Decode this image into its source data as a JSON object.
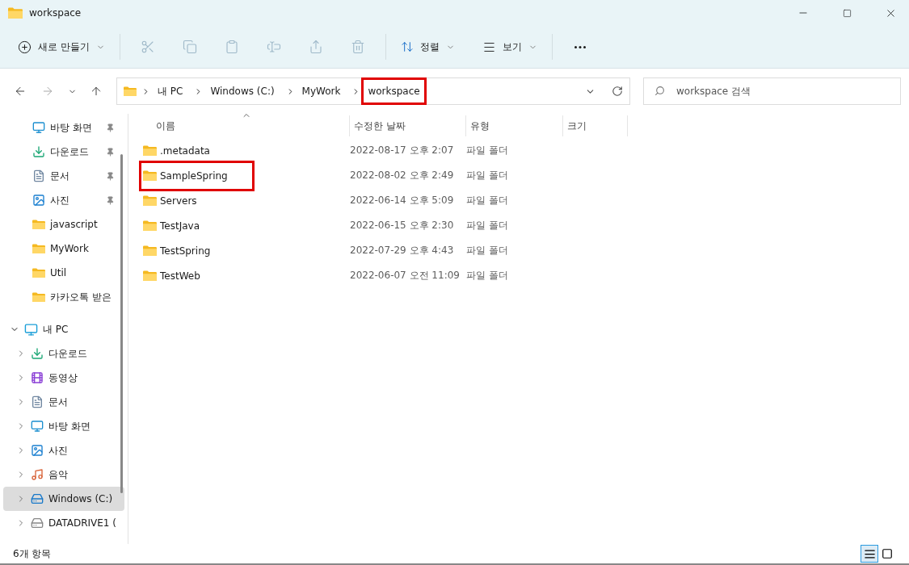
{
  "window": {
    "title": "workspace"
  },
  "toolbar": {
    "new_label": "새로 만들기",
    "actions": [
      {
        "kind": "cut",
        "disabled": true
      },
      {
        "kind": "copy",
        "disabled": true
      },
      {
        "kind": "paste",
        "disabled": true
      },
      {
        "kind": "rename",
        "disabled": true
      },
      {
        "kind": "share",
        "disabled": true
      },
      {
        "kind": "delete",
        "disabled": true
      }
    ],
    "sort_label": "정렬",
    "view_label": "보기"
  },
  "navigation": {
    "back_disabled": false,
    "forward_disabled": true
  },
  "breadcrumb": [
    {
      "label": "내 PC",
      "highlighted": false
    },
    {
      "label": "Windows  (C:)",
      "highlighted": false
    },
    {
      "label": "MyWork",
      "highlighted": false
    },
    {
      "label": "workspace",
      "highlighted": true
    }
  ],
  "search": {
    "placeholder": "workspace 검색"
  },
  "sidebar": {
    "quick_access": [
      {
        "label": "바탕 화면",
        "kind": "desktop",
        "pinned": true
      },
      {
        "label": "다운로드",
        "kind": "download",
        "pinned": true
      },
      {
        "label": "문서",
        "kind": "documents",
        "pinned": true
      },
      {
        "label": "사진",
        "kind": "pictures",
        "pinned": true
      },
      {
        "label": "javascript",
        "kind": "folder",
        "pinned": false
      },
      {
        "label": "MyWork",
        "kind": "folder",
        "pinned": false
      },
      {
        "label": "Util",
        "kind": "folder",
        "pinned": false
      },
      {
        "label": "카카오톡 받은",
        "kind": "folder",
        "pinned": false
      }
    ],
    "this_pc": {
      "label": "내 PC",
      "expanded": true,
      "children": [
        {
          "label": "다운로드",
          "kind": "download",
          "selected": false
        },
        {
          "label": "동영상",
          "kind": "videos",
          "selected": false
        },
        {
          "label": "문서",
          "kind": "documents",
          "selected": false
        },
        {
          "label": "바탕 화면",
          "kind": "desktop",
          "selected": false
        },
        {
          "label": "사진",
          "kind": "pictures",
          "selected": false
        },
        {
          "label": "음악",
          "kind": "music",
          "selected": false
        },
        {
          "label": "Windows  (C:)",
          "kind": "drive",
          "selected": true
        },
        {
          "label": "DATADRIVE1 (",
          "kind": "drive2",
          "selected": false
        }
      ]
    }
  },
  "table": {
    "columns": [
      {
        "label": "이름",
        "sorted": true
      },
      {
        "label": "수정한 날짜",
        "sorted": false
      },
      {
        "label": "유형",
        "sorted": false
      },
      {
        "label": "크기",
        "sorted": false
      }
    ],
    "rows": [
      {
        "name": ".metadata",
        "modified": "2022-08-17 오후 2:07",
        "type": "파일 폴더",
        "highlighted": false
      },
      {
        "name": "SampleSpring",
        "modified": "2022-08-02 오후 2:49",
        "type": "파일 폴더",
        "highlighted": true
      },
      {
        "name": "Servers",
        "modified": "2022-06-14 오후 5:09",
        "type": "파일 폴더",
        "highlighted": false
      },
      {
        "name": "TestJava",
        "modified": "2022-06-15 오후 2:30",
        "type": "파일 폴더",
        "highlighted": false
      },
      {
        "name": "TestSpring",
        "modified": "2022-07-29 오후 4:43",
        "type": "파일 폴더",
        "highlighted": false
      },
      {
        "name": "TestWeb",
        "modified": "2022-06-07 오전 11:09",
        "type": "파일 폴더",
        "highlighted": false
      }
    ]
  },
  "status_bar": {
    "count": "6개 항목",
    "views": [
      {
        "kind": "details",
        "selected": true
      },
      {
        "kind": "tiles",
        "selected": false
      }
    ]
  }
}
